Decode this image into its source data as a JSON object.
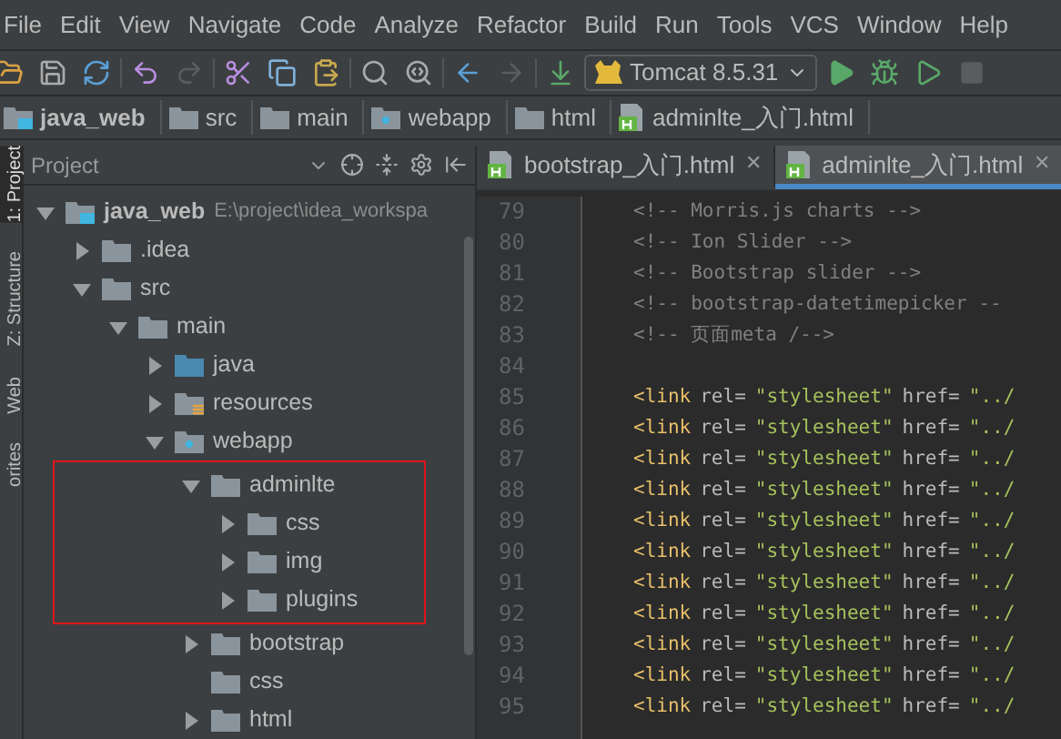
{
  "menu": [
    "File",
    "Edit",
    "View",
    "Navigate",
    "Code",
    "Analyze",
    "Refactor",
    "Build",
    "Run",
    "Tools",
    "VCS",
    "Window",
    "Help"
  ],
  "run_config": {
    "label": "Tomcat 8.5.31"
  },
  "breadcrumb": [
    {
      "label": "java_web",
      "kind": "module"
    },
    {
      "label": "src",
      "kind": "folder"
    },
    {
      "label": "main",
      "kind": "folder"
    },
    {
      "label": "webapp",
      "kind": "web"
    },
    {
      "label": "html",
      "kind": "folder"
    },
    {
      "label": "adminlte_入门.html",
      "kind": "html"
    }
  ],
  "side_tabs": [
    {
      "label": "1: Project",
      "selected": true
    },
    {
      "label": "Z: Structure",
      "selected": false
    },
    {
      "label": "Web",
      "selected": false
    },
    {
      "label": "orites",
      "selected": false
    }
  ],
  "project_panel": {
    "title": "Project",
    "tree": [
      {
        "name": "java_web",
        "kind": "module",
        "path": "E:\\project\\idea_workspa",
        "expanded": true,
        "children": [
          {
            "name": ".idea",
            "kind": "folder",
            "expanded": false
          },
          {
            "name": "src",
            "kind": "folder",
            "expanded": true,
            "children": [
              {
                "name": "main",
                "kind": "folder",
                "expanded": true,
                "children": [
                  {
                    "name": "java",
                    "kind": "source",
                    "expanded": false
                  },
                  {
                    "name": "resources",
                    "kind": "resources",
                    "expanded": false
                  },
                  {
                    "name": "webapp",
                    "kind": "web",
                    "expanded": true,
                    "children": [
                      {
                        "name": "adminlte",
                        "kind": "folder",
                        "expanded": true,
                        "highlighted": true,
                        "children": [
                          {
                            "name": "css",
                            "kind": "folder",
                            "expanded": false
                          },
                          {
                            "name": "img",
                            "kind": "folder",
                            "expanded": false
                          },
                          {
                            "name": "plugins",
                            "kind": "folder",
                            "expanded": false
                          }
                        ]
                      },
                      {
                        "name": "bootstrap",
                        "kind": "folder",
                        "expanded": false
                      },
                      {
                        "name": "css",
                        "kind": "folder"
                      },
                      {
                        "name": "html",
                        "kind": "folder",
                        "expanded": false
                      }
                    ]
                  }
                ]
              }
            ]
          }
        ]
      }
    ]
  },
  "editor": {
    "tabs": [
      {
        "label": "bootstrap_入门.html",
        "close": "✕",
        "selected": false
      },
      {
        "label": "adminlte_入门.html",
        "close": "✕",
        "selected": true
      }
    ],
    "lines": [
      {
        "number": "79",
        "segments": [
          {
            "kind": "comment",
            "text": "<!-- Morris.js charts -->"
          }
        ]
      },
      {
        "number": "80",
        "segments": [
          {
            "kind": "comment",
            "text": "<!-- Ion Slider -->"
          }
        ]
      },
      {
        "number": "81",
        "segments": [
          {
            "kind": "comment",
            "text": "<!-- Bootstrap slider -->"
          }
        ]
      },
      {
        "number": "82",
        "segments": [
          {
            "kind": "comment",
            "text": "<!-- bootstrap-datetimepicker --"
          }
        ]
      },
      {
        "number": "83",
        "segments": [
          {
            "kind": "comment",
            "text": "<!-- 页面meta /-->"
          }
        ]
      },
      {
        "number": "84"
      },
      {
        "number": "85",
        "segments": [
          {
            "kind": "tag",
            "text": "<link"
          },
          {
            "kind": "attr",
            "text": "rel="
          },
          {
            "kind": "string",
            "text": "\"stylesheet\""
          },
          {
            "kind": "attr",
            "text": "href="
          },
          {
            "kind": "string",
            "text": "\"../"
          }
        ]
      },
      {
        "number": "86",
        "segments": [
          {
            "kind": "tag",
            "text": "<link"
          },
          {
            "kind": "attr",
            "text": "rel="
          },
          {
            "kind": "string",
            "text": "\"stylesheet\""
          },
          {
            "kind": "attr",
            "text": "href="
          },
          {
            "kind": "string",
            "text": "\"../"
          }
        ]
      },
      {
        "number": "87",
        "segments": [
          {
            "kind": "tag",
            "text": "<link"
          },
          {
            "kind": "attr",
            "text": "rel="
          },
          {
            "kind": "string",
            "text": "\"stylesheet\""
          },
          {
            "kind": "attr",
            "text": "href="
          },
          {
            "kind": "string",
            "text": "\"../"
          }
        ]
      },
      {
        "number": "88",
        "segments": [
          {
            "kind": "tag",
            "text": "<link"
          },
          {
            "kind": "attr",
            "text": "rel="
          },
          {
            "kind": "string",
            "text": "\"stylesheet\""
          },
          {
            "kind": "attr",
            "text": "href="
          },
          {
            "kind": "string",
            "text": "\"../"
          }
        ]
      },
      {
        "number": "89",
        "segments": [
          {
            "kind": "tag",
            "text": "<link"
          },
          {
            "kind": "attr",
            "text": "rel="
          },
          {
            "kind": "string",
            "text": "\"stylesheet\""
          },
          {
            "kind": "attr",
            "text": "href="
          },
          {
            "kind": "string",
            "text": "\"../"
          }
        ]
      },
      {
        "number": "90",
        "segments": [
          {
            "kind": "tag",
            "text": "<link"
          },
          {
            "kind": "attr",
            "text": "rel="
          },
          {
            "kind": "string",
            "text": "\"stylesheet\""
          },
          {
            "kind": "attr",
            "text": "href="
          },
          {
            "kind": "string",
            "text": "\"../"
          }
        ]
      },
      {
        "number": "91",
        "segments": [
          {
            "kind": "tag",
            "text": "<link"
          },
          {
            "kind": "attr",
            "text": "rel="
          },
          {
            "kind": "string",
            "text": "\"stylesheet\""
          },
          {
            "kind": "attr",
            "text": "href="
          },
          {
            "kind": "string",
            "text": "\"../"
          }
        ]
      },
      {
        "number": "92",
        "segments": [
          {
            "kind": "tag",
            "text": "<link"
          },
          {
            "kind": "attr",
            "text": "rel="
          },
          {
            "kind": "string",
            "text": "\"stylesheet\""
          },
          {
            "kind": "attr",
            "text": "href="
          },
          {
            "kind": "string",
            "text": "\"../"
          }
        ]
      },
      {
        "number": "93",
        "segments": [
          {
            "kind": "tag",
            "text": "<link"
          },
          {
            "kind": "attr",
            "text": "rel="
          },
          {
            "kind": "string",
            "text": "\"stylesheet\""
          },
          {
            "kind": "attr",
            "text": "href="
          },
          {
            "kind": "string",
            "text": "\"../"
          }
        ]
      },
      {
        "number": "94",
        "segments": [
          {
            "kind": "tag",
            "text": "<link"
          },
          {
            "kind": "attr",
            "text": "rel="
          },
          {
            "kind": "string",
            "text": "\"stylesheet\""
          },
          {
            "kind": "attr",
            "text": "href="
          },
          {
            "kind": "string",
            "text": "\"../"
          }
        ]
      },
      {
        "number": "95",
        "segments": [
          {
            "kind": "tag",
            "text": "<link"
          },
          {
            "kind": "attr",
            "text": "rel="
          },
          {
            "kind": "string",
            "text": "\"stylesheet\""
          },
          {
            "kind": "attr",
            "text": "href="
          },
          {
            "kind": "string",
            "text": "\"../"
          }
        ]
      }
    ]
  }
}
